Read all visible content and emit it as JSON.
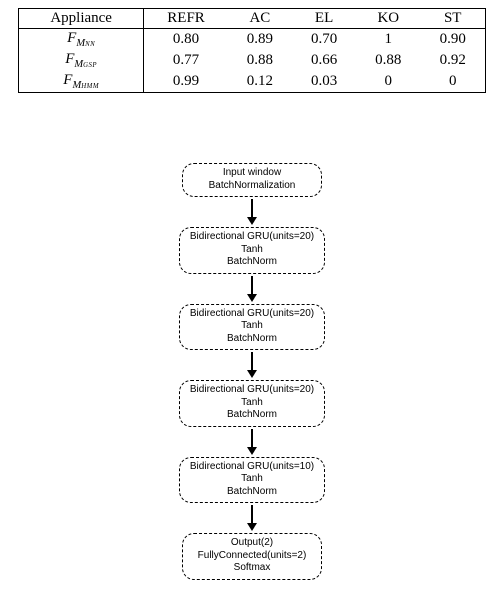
{
  "table": {
    "header": [
      "Appliance",
      "REFR",
      "AC",
      "EL",
      "KO",
      "ST"
    ],
    "rows": [
      {
        "label_main": "F",
        "label_sub": "M",
        "label_subsub": "NN",
        "vals": [
          "0.80",
          "0.89",
          "0.70",
          "1",
          "0.90"
        ]
      },
      {
        "label_main": "F",
        "label_sub": "M",
        "label_subsub": "GSP",
        "vals": [
          "0.77",
          "0.88",
          "0.66",
          "0.88",
          "0.92"
        ]
      },
      {
        "label_main": "F",
        "label_sub": "M",
        "label_subsub": "HMM",
        "vals": [
          "0.99",
          "0.12",
          "0.03",
          "0",
          "0"
        ]
      }
    ]
  },
  "diagram": {
    "nodes": [
      {
        "lines": [
          "Input window",
          "BatchNormalization"
        ]
      },
      {
        "lines": [
          "Bidirectional GRU(units=20)",
          "Tanh",
          "BatchNorm"
        ]
      },
      {
        "lines": [
          "Bidirectional GRU(units=20)",
          "Tanh",
          "BatchNorm"
        ]
      },
      {
        "lines": [
          "Bidirectional GRU(units=20)",
          "Tanh",
          "BatchNorm"
        ]
      },
      {
        "lines": [
          "Bidirectional GRU(units=10)",
          "Tanh",
          "BatchNorm"
        ]
      },
      {
        "lines": [
          "Output(2)",
          "FullyConnected(units=2)",
          "Softmax"
        ]
      }
    ]
  },
  "chart_data": {
    "type": "table",
    "title": "",
    "columns": [
      "Appliance",
      "REFR",
      "AC",
      "EL",
      "KO",
      "ST"
    ],
    "rows": [
      [
        "F_M_NN",
        0.8,
        0.89,
        0.7,
        1.0,
        0.9
      ],
      [
        "F_M_GSP",
        0.77,
        0.88,
        0.66,
        0.88,
        0.92
      ],
      [
        "F_M_HMM",
        0.99,
        0.12,
        0.03,
        0.0,
        0.0
      ]
    ]
  }
}
